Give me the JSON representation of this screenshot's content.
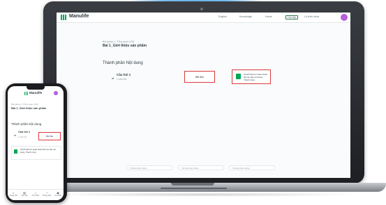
{
  "laptop": {
    "header": {
      "brand": "Manulife",
      "nav": [
        "English",
        "Knowledge",
        "Home",
        "Học tập",
        "Lộ trình khóa"
      ]
    },
    "lesson": {
      "breadcrumb": "Bài giảng 1 | Tổng quan (VN)",
      "title": "Bài 1_Giới thiệu sản phẩm"
    },
    "content_section": {
      "title": "Thành phần Nội dung",
      "item_title": "Câu hỏi 1",
      "item_subtitle": "1 câu hỏi",
      "start_button": "Bắt đầu"
    },
    "info_card": {
      "text": "Chuỗi bài học hoàn thành để học tiếp nội dung, Thành công"
    },
    "footer_pills": [
      "Tài liệu tham khảo",
      "Tài liệu tham khảo",
      "Tài liệu tham khảo"
    ]
  },
  "phone": {
    "brand": "Manulife",
    "lesson": {
      "breadcrumb": "Bài giảng 1 | Tổng quan (VN)",
      "title": "Bài 1_Giới thiệu sản phẩm"
    },
    "content_section": {
      "title": "Thành phần Nội dung",
      "item_title": "Câu hỏi 1",
      "item_subtitle": "1 câu hỏi",
      "start_button": "Bắt đầu"
    },
    "info_card": {
      "text": "Chuỗi bài học hoàn thành để học tiếp nội dung, Thành công"
    },
    "tabs": [
      {
        "label": "Trang chủ",
        "icon": "home-icon"
      },
      {
        "label": "Học tập",
        "icon": "book-icon"
      },
      {
        "label": "Tìm kiếm",
        "icon": "search-icon"
      },
      {
        "label": "Thông báo",
        "icon": "bell-icon"
      },
      {
        "label": "Cá nhân",
        "icon": "user-icon"
      }
    ]
  },
  "colors": {
    "brand_green": "#00a758",
    "highlight_red": "#d93a3a",
    "avatar_purple": "#b55ddb"
  }
}
